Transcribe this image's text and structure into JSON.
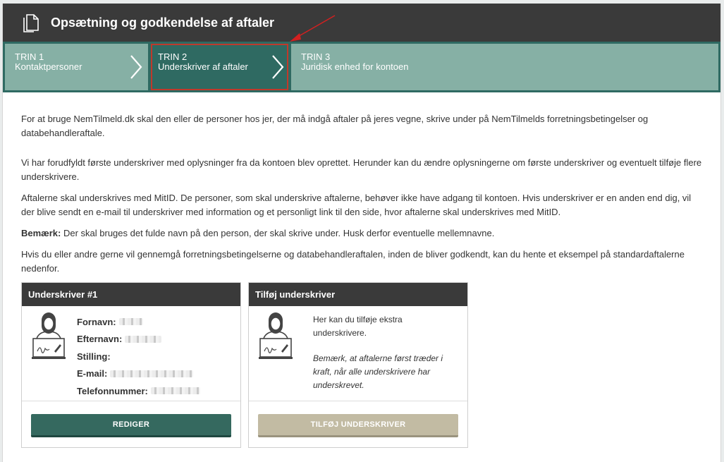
{
  "header": {
    "title": "Opsætning og godkendelse af aftaler",
    "icon": "document-copy-icon"
  },
  "steps": [
    {
      "number": "TRIN 1",
      "label": "Kontaktpersoner"
    },
    {
      "number": "TRIN 2",
      "label": "Underskriver af aftaler"
    },
    {
      "number": "TRIN 3",
      "label": "Juridisk enhed for kontoen"
    }
  ],
  "intro": {
    "p1": "For at bruge NemTilmeld.dk skal den eller de personer hos jer, der må indgå aftaler på jeres vegne, skrive under på NemTilmelds forretningsbetingelser og databehandleraftale.",
    "p2": "Vi har forudfyldt første underskriver med oplysninger fra da kontoen blev oprettet. Herunder kan du ændre oplysningerne om første underskriver og eventuelt tilføje flere underskrivere.",
    "p3": "Aftalerne skal underskrives med MitID. De personer, som skal underskrive aftalerne, behøver ikke have adgang til kontoen. Hvis underskriver er en anden end dig, vil der blive sendt en e-mail til underskriver med information og et personligt link til den side, hvor aftalerne skal underskrives med MitID.",
    "p4_bold": "Bemærk:",
    "p4_rest": " Der skal bruges det fulde navn på den person, der skal skrive under. Husk derfor eventuelle mellemnavne.",
    "p5": "Hvis du eller andre gerne vil gennemgå forretningsbetingelserne og databehandleraftalen, inden de bliver godkendt, kan du hente et eksempel på standardaftalerne nedenfor."
  },
  "signer_card": {
    "title": "Underskriver #1",
    "fields": {
      "first_name": "Fornavn:",
      "last_name": "Efternavn:",
      "position": "Stilling:",
      "email": "E-mail:",
      "phone": "Telefonnummer:"
    },
    "button": "REDIGER"
  },
  "add_card": {
    "title": "Tilføj underskriver",
    "text": "Her kan du tilføje ekstra underskrivere.",
    "note": "Bemærk, at aftalerne først træder i kraft, når alle underskrivere har underskrevet.",
    "button": "TILFØJ UNDERSKRIVER"
  },
  "colors": {
    "accent": "#35695f",
    "step_inactive": "#86b0a5",
    "header": "#3a3a3a",
    "highlight": "#c0392b"
  }
}
